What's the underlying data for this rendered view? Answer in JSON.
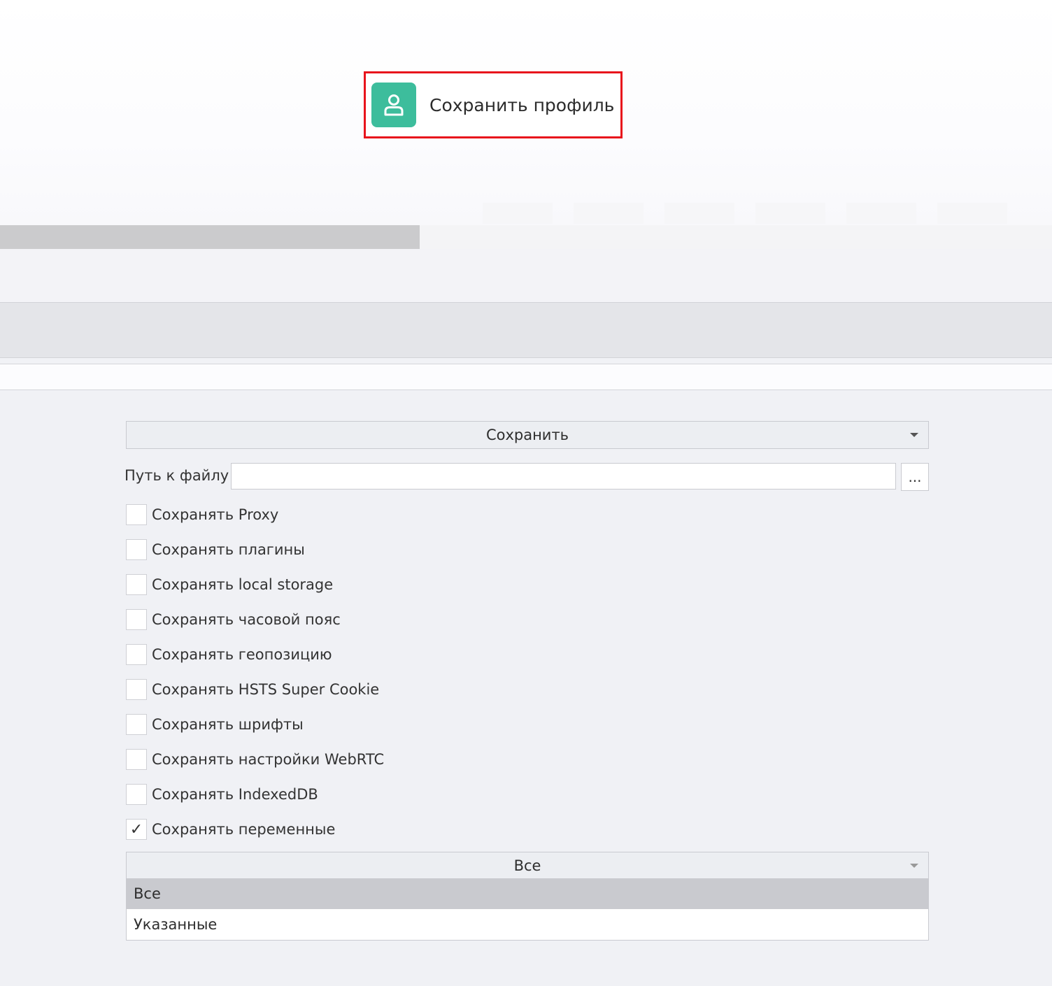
{
  "action": {
    "label": "Сохранить профиль",
    "icon": "user-icon",
    "icon_color": "#3dbd9c",
    "highlight_color": "#e8141c"
  },
  "form": {
    "mode_dropdown": {
      "value": "Сохранить"
    },
    "file_path": {
      "label": "Путь к файлу",
      "value": "",
      "browse_label": "..."
    },
    "checkboxes": [
      {
        "label": "Сохранять Proxy",
        "checked": false
      },
      {
        "label": "Сохранять плагины",
        "checked": false
      },
      {
        "label": "Сохранять local storage",
        "checked": false
      },
      {
        "label": "Сохранять часовой пояс",
        "checked": false
      },
      {
        "label": "Сохранять геопозицию",
        "checked": false
      },
      {
        "label": "Сохранять HSTS Super Cookie",
        "checked": false
      },
      {
        "label": "Сохранять шрифты",
        "checked": false
      },
      {
        "label": "Сохранять настройки WebRTC",
        "checked": false
      },
      {
        "label": "Сохранять IndexedDB",
        "checked": false
      },
      {
        "label": "Сохранять переменные",
        "checked": true
      }
    ],
    "variables_dropdown": {
      "value": "Все",
      "options": [
        {
          "label": "Все",
          "selected": true
        },
        {
          "label": "Указанные",
          "selected": false
        }
      ]
    }
  }
}
